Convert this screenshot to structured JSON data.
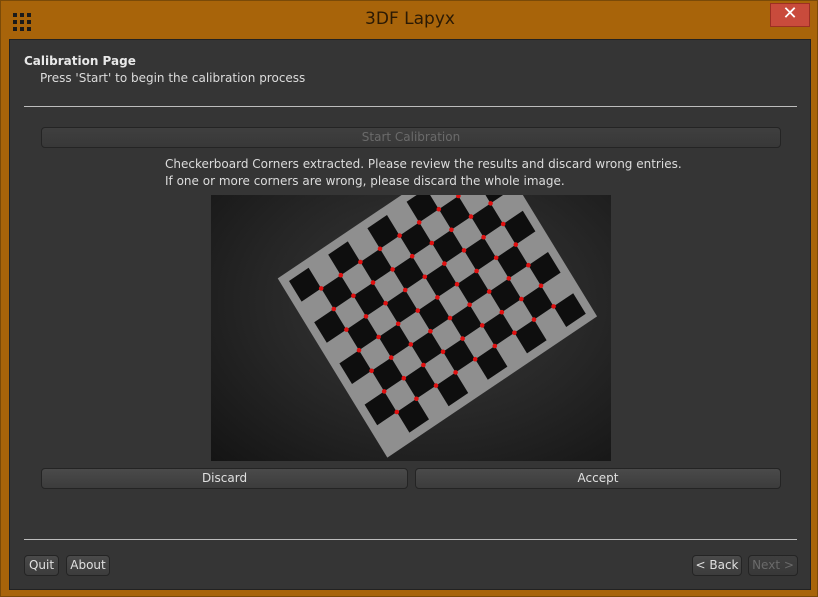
{
  "window": {
    "title": "3DF Lapyx",
    "close_label": "✕"
  },
  "page": {
    "title": "Calibration Page",
    "subtitle": "Press 'Start' to begin the calibration process"
  },
  "start_button": {
    "label": "Start Calibration",
    "enabled": false
  },
  "instructions": {
    "line1": "Checkerboard Corners extracted. Please review the results and discard wrong entries.",
    "line2": "If one or more corners are wrong, please discard the whole image."
  },
  "actions": {
    "discard_label": "Discard",
    "accept_label": "Accept"
  },
  "footer": {
    "quit_label": "Quit",
    "about_label": "About",
    "back_label": "< Back",
    "next_label": "Next >"
  },
  "colors": {
    "frame": "#a8640a",
    "panel": "#353535",
    "corner_marker": "#e01010",
    "close_button": "#c94b3c"
  },
  "icons": {
    "app": "grid-icon",
    "close": "close-icon"
  }
}
